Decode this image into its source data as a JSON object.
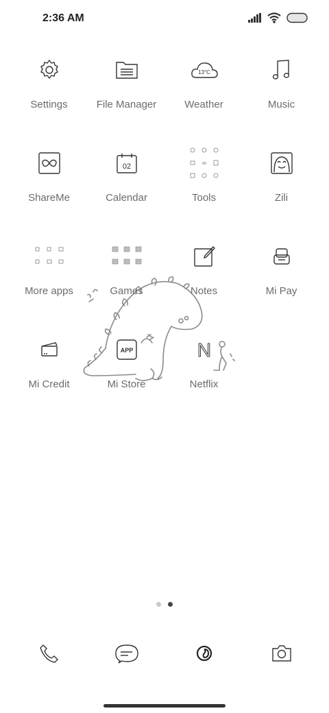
{
  "status_bar": {
    "time": "2:36 AM",
    "icons": [
      "cellular-signal-icon",
      "wifi-icon",
      "battery-icon"
    ]
  },
  "apps": [
    {
      "name": "settings",
      "label": "Settings",
      "icon": "gear-icon"
    },
    {
      "name": "file-manager",
      "label": "File Manager",
      "icon": "folder-icon"
    },
    {
      "name": "weather",
      "label": "Weather",
      "icon": "cloud-icon",
      "icon_text": "13°C"
    },
    {
      "name": "music",
      "label": "Music",
      "icon": "music-note-icon"
    },
    {
      "name": "shareme",
      "label": "ShareMe",
      "icon": "infinity-icon"
    },
    {
      "name": "calendar",
      "label": "Calendar",
      "icon": "calendar-icon",
      "icon_text": "02"
    },
    {
      "name": "tools",
      "label": "Tools",
      "icon": "tools-folder-icon"
    },
    {
      "name": "zili",
      "label": "Zili",
      "icon": "face-icon"
    },
    {
      "name": "more-apps",
      "label": "More apps",
      "icon": "apps-folder-icon"
    },
    {
      "name": "games",
      "label": "Games",
      "icon": "games-folder-icon"
    },
    {
      "name": "notes",
      "label": "Notes",
      "icon": "note-pen-icon"
    },
    {
      "name": "mi-pay",
      "label": "Mi Pay",
      "icon": "wallet-icon"
    },
    {
      "name": "mi-credit",
      "label": "Mi Credit",
      "icon": "credit-card-icon"
    },
    {
      "name": "mi-store",
      "label": "Mi Store",
      "icon": "store-app-icon",
      "icon_text": "APP"
    },
    {
      "name": "netflix",
      "label": "Netflix",
      "icon": "netflix-n-icon",
      "icon_text": "N"
    }
  ],
  "page_indicator": {
    "pages": 2,
    "current": 2
  },
  "dock": [
    {
      "name": "phone",
      "icon": "phone-icon"
    },
    {
      "name": "messages",
      "icon": "chat-bubble-icon"
    },
    {
      "name": "browser",
      "icon": "browser-icon"
    },
    {
      "name": "camera",
      "icon": "camera-icon"
    }
  ],
  "colors": {
    "label": "#6b6b6b",
    "icon_stroke": "#333333",
    "background": "#ffffff"
  }
}
